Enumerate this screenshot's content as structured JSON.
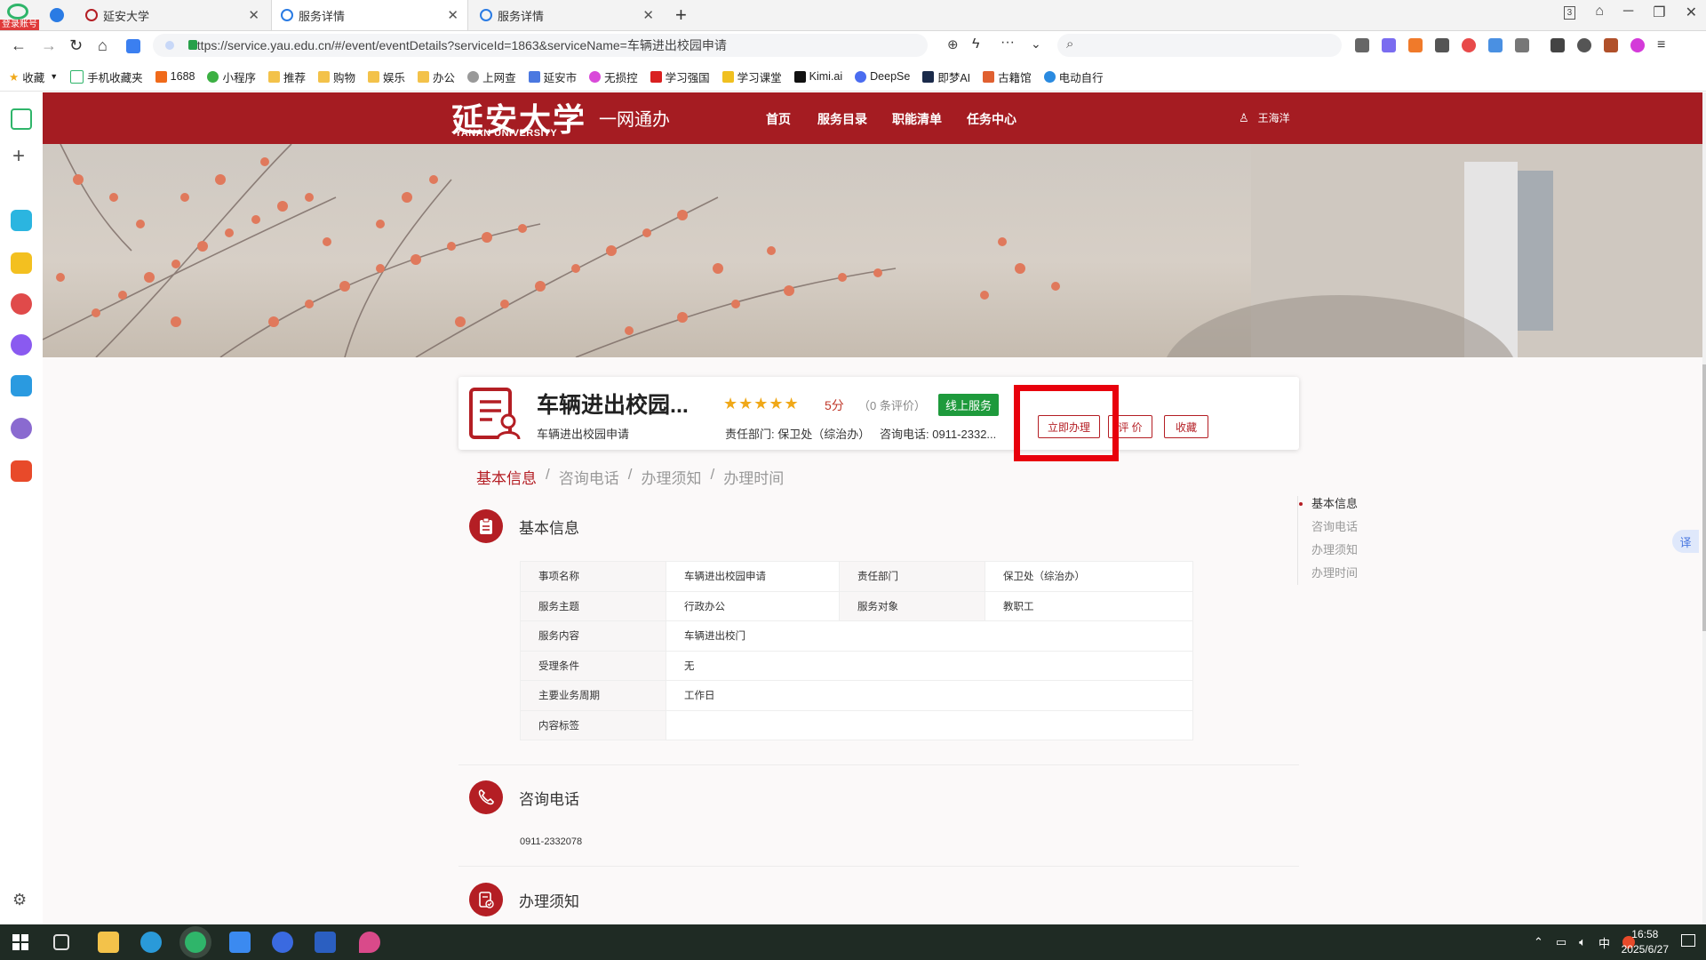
{
  "browser": {
    "badge": "登录账号",
    "tabs": [
      {
        "label": "延安大学"
      },
      {
        "label": "服务详情"
      },
      {
        "label": "服务详情"
      }
    ],
    "tab_count": "3",
    "url": "https://service.yau.edu.cn/#/event/eventDetails?serviceId=1863&serviceName=车辆进出校园申请",
    "bookmarks": [
      "收藏",
      "手机收藏夹",
      "1688",
      "小程序",
      "推荐",
      "购物",
      "娱乐",
      "办公",
      "上网查",
      "延安市",
      "无损控",
      "学习强国",
      "学习课堂",
      "Kimi.ai",
      "DeepSe",
      "即梦AI",
      "古籍馆",
      "电动自行"
    ]
  },
  "site": {
    "logo_cn": "延安大学",
    "logo_en": "YANAN UNIVERSITY",
    "slogan": "一网通办",
    "nav": [
      "首页",
      "服务目录",
      "职能清单",
      "任务中心"
    ],
    "user_name": "王海洋"
  },
  "service": {
    "title": "车辆进出校园...",
    "subtitle": "车辆进出校园申请",
    "stars": "★★★★★",
    "score": "5分",
    "reviews": "（0 条评价）",
    "badge": "线上服务",
    "department": "责任部门: 保卫处（综治办）",
    "phone": "咨询电话: 0911-2332...",
    "btn_apply": "立即办理",
    "btn_rate": "评 价",
    "btn_fav": "收藏"
  },
  "anchors": [
    "基本信息",
    "咨询电话",
    "办理须知",
    "办理时间"
  ],
  "sections": {
    "basic": "基本信息",
    "contact": "咨询电话",
    "notice": "办理须知"
  },
  "table": {
    "r1": {
      "k1": "事项名称",
      "v1": "车辆进出校园申请",
      "k2": "责任部门",
      "v2": "保卫处（综治办）"
    },
    "r2": {
      "k1": "服务主题",
      "v1": "行政办公",
      "k2": "服务对象",
      "v2": "教职工"
    },
    "r3": {
      "k": "服务内容",
      "v": "车辆进出校门"
    },
    "r4": {
      "k": "受理条件",
      "v": "无"
    },
    "r5": {
      "k": "主要业务周期",
      "v": "工作日"
    },
    "r6": {
      "k": "内容标签",
      "v": ""
    }
  },
  "contact_phone": "0911-2332078",
  "right_nav": [
    "基本信息",
    "咨询电话",
    "办理须知",
    "办理时间"
  ],
  "translate_label": "译",
  "taskbar": {
    "ime": "中",
    "time": "16:58",
    "date": "2025/6/27"
  },
  "colors": {
    "brand_red": "#a51c22",
    "highlight": "#e8000c",
    "online_green": "#1e9a3c",
    "star": "#f0a818"
  }
}
